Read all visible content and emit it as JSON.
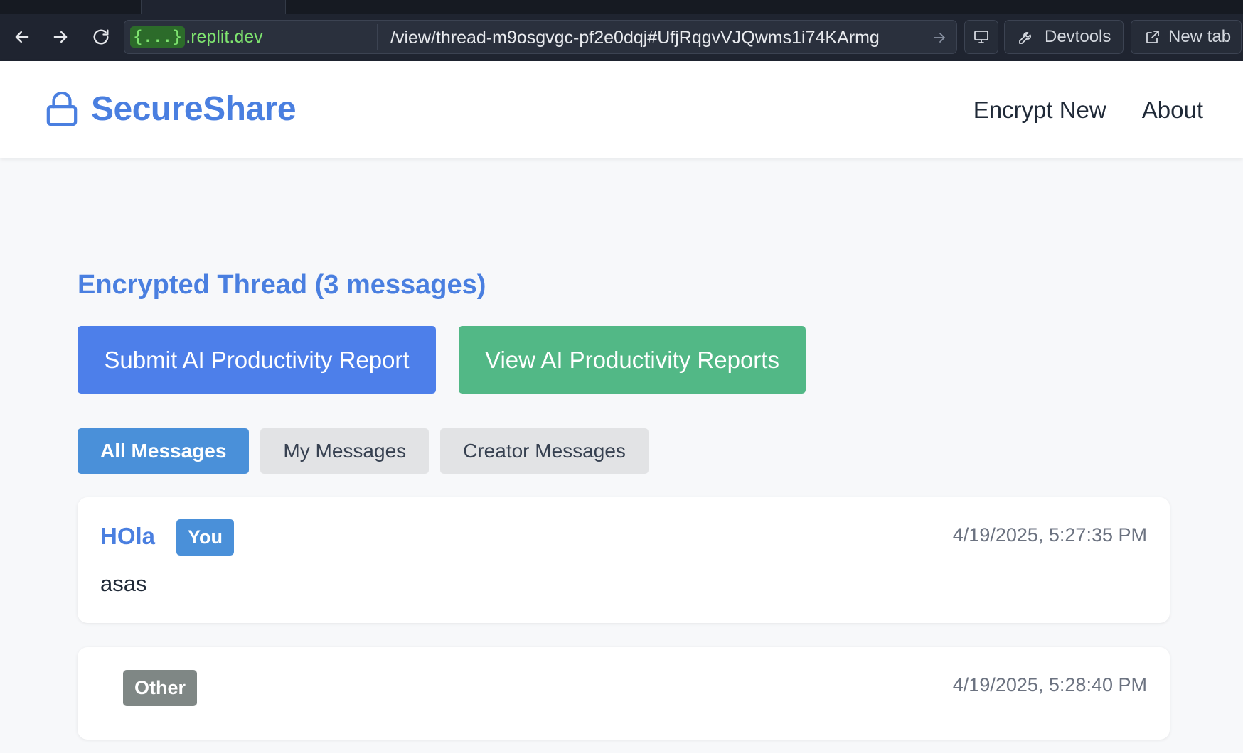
{
  "browser": {
    "url_host_badge": "{...}",
    "url_host_rest": ".replit.dev",
    "url_path": "/view/thread-m9osgvgc-pf2e0dqj#UfjRqgvVJQwms1i74KArmg",
    "devtools_label": "Devtools",
    "new_tab_label": "New tab"
  },
  "header": {
    "brand": "SecureShare",
    "nav": [
      "Encrypt New",
      "About"
    ]
  },
  "main": {
    "title": "Encrypted Thread (3 messages)",
    "submit_report_label": "Submit AI Productivity Report",
    "view_reports_label": "View AI Productivity Reports",
    "filters": [
      "All Messages",
      "My Messages",
      "Creator Messages"
    ],
    "messages": [
      {
        "author": "HOla",
        "badge": "You",
        "timestamp": "4/19/2025, 5:27:35 PM",
        "body": "asas"
      },
      {
        "author": "",
        "badge": "Other",
        "timestamp": "4/19/2025, 5:28:40 PM",
        "body": ""
      }
    ]
  },
  "colors": {
    "brand_blue": "#4a7fe0",
    "submit_blue": "#4d7fea",
    "view_green": "#52b886",
    "active_tab": "#4a90d9",
    "other_badge": "#7f8785"
  }
}
